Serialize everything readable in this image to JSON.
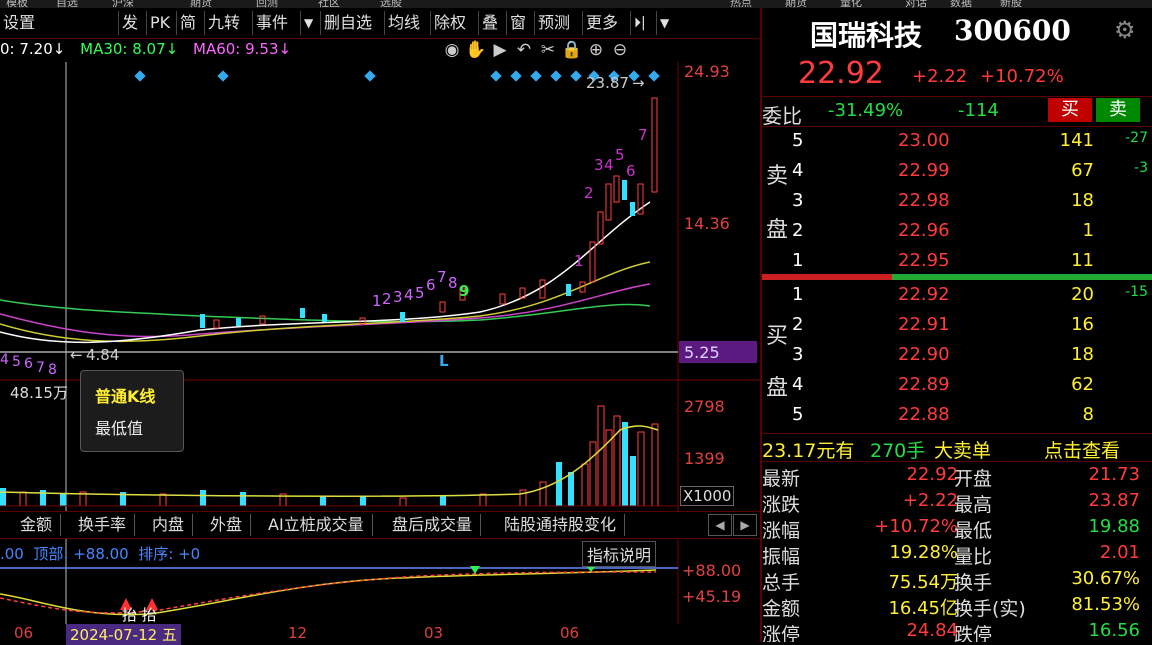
{
  "menubar": [
    "模板",
    "自选",
    "沪深",
    "期货",
    "回测",
    "社区",
    "选股",
    "热点",
    "期货",
    "量化",
    "对话",
    "数据",
    "新股",
    "宏观",
    "全球"
  ],
  "toolbar": {
    "settings": "设置",
    "buttons": [
      "发",
      "PK",
      "简",
      "九转",
      "事件",
      "▼",
      "删自选",
      "均线",
      "除权",
      "叠",
      "窗",
      "预测",
      "更多",
      "⏵|",
      "▼"
    ]
  },
  "ma": {
    "ma10": "0: 7.20↓",
    "ma30": "MA30: 8.07↓",
    "ma60": "MA60: 9.53↓"
  },
  "chart_icons": [
    "◉",
    "✋",
    "▶",
    "↶",
    "✂",
    "🔒",
    "⊕",
    "⊖"
  ],
  "price_axis": {
    "top": "24.93",
    "mid": "14.36",
    "low": "5.25",
    "high_label": "23.87",
    "low_label": "4.84",
    "l_marker": "L"
  },
  "counts": {
    "wave1": [
      "1",
      "2",
      "3",
      "4",
      "5",
      "6",
      "7",
      "8",
      "9"
    ],
    "wave2": [
      "1",
      "2",
      "3",
      "4",
      "5",
      "6",
      "7"
    ],
    "bottom": [
      "4",
      "5",
      "6",
      "7",
      "8"
    ]
  },
  "volume": {
    "label": "48.15万",
    "v1": "2798",
    "v2": "1399",
    "unit": "X1000"
  },
  "tooltip": {
    "title": "普通K线",
    "line": "最低值"
  },
  "indicator_tabs": [
    "金额",
    "换手率",
    "内盘",
    "外盘",
    "AI立桩成交量",
    "盘后成交量",
    "陆股通持股变化"
  ],
  "indicator": {
    "line": ".00  顶部: +88.00  排序: +0",
    "explain": "指标说明",
    "top": "+88.00",
    "mid": "+45.19",
    "markers": "抬 抬"
  },
  "bottom_axis": {
    "d1": "06",
    "cursor_date": "2024-07-12 五",
    "d2": "12",
    "d3": "03",
    "d4": "06"
  },
  "stock": {
    "name": "国瑞科技",
    "code": "300600",
    "price": "22.92",
    "change": "+2.22",
    "pct": "+10.72%"
  },
  "weibi": {
    "label": "委比",
    "pct": "-31.49%",
    "diff": "-114",
    "buy_btn": "买",
    "sell_btn": "卖"
  },
  "sell_side_label": [
    "卖",
    "盘"
  ],
  "buy_side_label": [
    "买",
    "盘"
  ],
  "sells": [
    {
      "lvl": "5",
      "price": "23.00",
      "vol": "141",
      "chg": "-27"
    },
    {
      "lvl": "4",
      "price": "22.99",
      "vol": "67",
      "chg": "-3"
    },
    {
      "lvl": "3",
      "price": "22.98",
      "vol": "18",
      "chg": ""
    },
    {
      "lvl": "2",
      "price": "22.96",
      "vol": "1",
      "chg": ""
    },
    {
      "lvl": "1",
      "price": "22.95",
      "vol": "11",
      "chg": ""
    }
  ],
  "buys": [
    {
      "lvl": "1",
      "price": "22.92",
      "vol": "20",
      "chg": "-15"
    },
    {
      "lvl": "2",
      "price": "22.91",
      "vol": "16",
      "chg": ""
    },
    {
      "lvl": "3",
      "price": "22.90",
      "vol": "18",
      "chg": ""
    },
    {
      "lvl": "4",
      "price": "22.89",
      "vol": "62",
      "chg": ""
    },
    {
      "lvl": "5",
      "price": "22.88",
      "vol": "8",
      "chg": ""
    }
  ],
  "bigorder": {
    "price": "23.17元有",
    "qty": "270手",
    "text": "大卖单",
    "link": "点击查看"
  },
  "stats": [
    {
      "l1": "最新",
      "v1": "22.92",
      "c1": "red",
      "l2": "开盘",
      "v2": "21.73",
      "c2": "red"
    },
    {
      "l1": "涨跌",
      "v1": "+2.22",
      "c1": "red",
      "l2": "最高",
      "v2": "23.87",
      "c2": "red"
    },
    {
      "l1": "涨幅",
      "v1": "+10.72%",
      "c1": "red",
      "l2": "最低",
      "v2": "19.88",
      "c2": "green"
    },
    {
      "l1": "振幅",
      "v1": "19.28%",
      "c1": "yellow",
      "l2": "量比",
      "v2": "2.01",
      "c2": "red"
    },
    {
      "l1": "总手",
      "v1": "75.54万",
      "c1": "yellow",
      "l2": "换手",
      "v2": "30.67%",
      "c2": "yellow"
    },
    {
      "l1": "金额",
      "v1": "16.45亿",
      "c1": "yellow",
      "l2": "换手(实)",
      "v2": "81.53%",
      "c2": "yellow"
    },
    {
      "l1": "涨停",
      "v1": "24.84",
      "c1": "red",
      "l2": "跌停",
      "v2": "16.56",
      "c2": "green"
    }
  ]
}
